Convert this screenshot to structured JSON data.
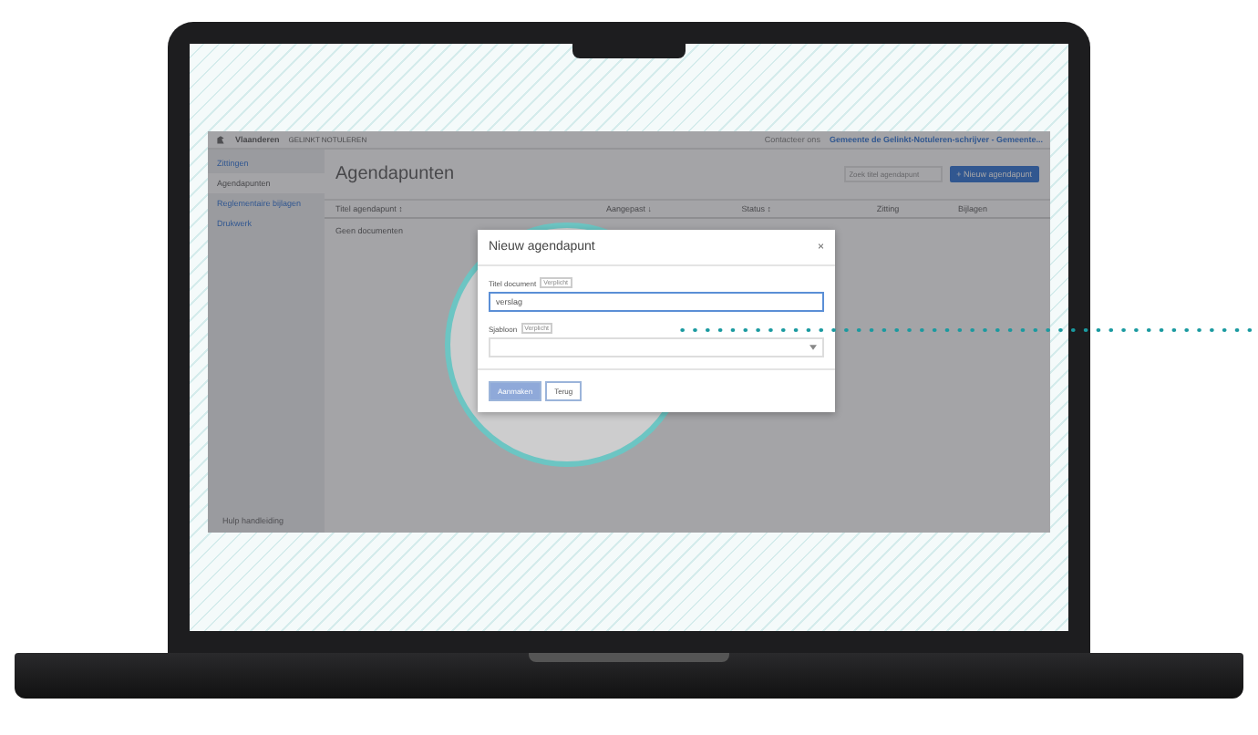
{
  "app": {
    "brand": "Vlaanderen",
    "product": "GELINKT NOTULEREN",
    "contact": "Contacteer ons",
    "account": "Gemeente de Gelinkt-Notuleren-schrijver - Gemeente..."
  },
  "sidebar": {
    "items": [
      {
        "label": "Zittingen",
        "selected": false
      },
      {
        "label": "Agendapunten",
        "selected": true
      },
      {
        "label": "Reglementaire bijlagen",
        "selected": false
      },
      {
        "label": "Drukwerk",
        "selected": false
      }
    ],
    "help": "Hulp handleiding"
  },
  "page": {
    "title": "Agendapunten",
    "search": {
      "placeholder": "Zoek titel agendapunt"
    },
    "new_button": "+ Nieuw agendapunt"
  },
  "table": {
    "columns": [
      "Titel agendapunt ↕",
      "Aangepast ↓",
      "Status ↕",
      "Zitting",
      "Bijlagen"
    ],
    "empty": "Geen documenten"
  },
  "dialog": {
    "title": "Nieuw agendapunt",
    "close": "×",
    "fields": [
      {
        "kind": "text",
        "label": "Titel document",
        "badge": "Verplicht",
        "value": "verslag"
      },
      {
        "kind": "select",
        "label": "Sjabloon",
        "badge": "Verplicht"
      }
    ],
    "buttons": [
      {
        "label": "Aanmaken",
        "primary": true
      },
      {
        "label": "Terug",
        "primary": false
      }
    ]
  }
}
